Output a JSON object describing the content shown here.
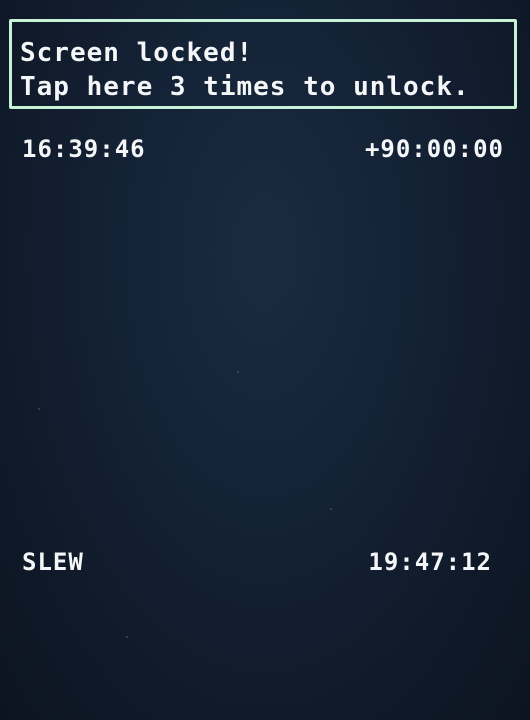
{
  "lock_banner": {
    "line1": "Screen locked!",
    "line2": "Tap here 3 times to unlock.",
    "border_color": "#c8f2d8"
  },
  "status": {
    "top_left_time": "16:39:46",
    "top_right_offset": "+90:00:00",
    "bottom_left_mode": "SLEW",
    "bottom_right_time": "19:47:12"
  },
  "colors": {
    "background": "#142236",
    "text": "#f4f6f8"
  }
}
